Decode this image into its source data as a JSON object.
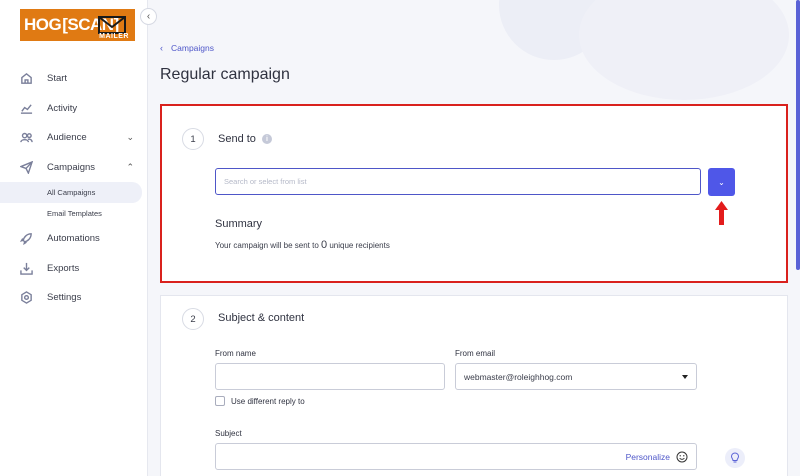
{
  "logo": {
    "hog": "HOG",
    "scan": "[SCAN]",
    "mailer": "MAILER"
  },
  "sidebar": {
    "items": [
      {
        "label": "Start",
        "icon": "home-icon"
      },
      {
        "label": "Activity",
        "icon": "chart-icon"
      },
      {
        "label": "Audience",
        "icon": "users-icon",
        "chevron": "⌄"
      },
      {
        "label": "Campaigns",
        "icon": "send-icon",
        "chevron": "⌃"
      },
      {
        "label": "Automations",
        "icon": "rocket-icon"
      },
      {
        "label": "Exports",
        "icon": "download-icon"
      },
      {
        "label": "Settings",
        "icon": "gear-icon"
      }
    ],
    "sub_items": [
      {
        "label": "All Campaigns",
        "active": true
      },
      {
        "label": "Email Templates",
        "active": false
      }
    ]
  },
  "breadcrumb": {
    "label": "Campaigns"
  },
  "page": {
    "title": "Regular campaign"
  },
  "send_to": {
    "step": "1",
    "title": "Send to",
    "placeholder": "Search or select from list",
    "summary_title": "Summary",
    "summary_prefix": "Your campaign will be sent to",
    "count": "0",
    "summary_suffix": "unique recipients"
  },
  "subject_content": {
    "step": "2",
    "title": "Subject & content",
    "from_name_label": "From name",
    "from_name_value": "",
    "from_email_label": "From email",
    "from_email_value": "webmaster@roleighhog.com",
    "reply_to_label": "Use different reply to",
    "subject_label": "Subject",
    "personalize_label": "Personalize"
  },
  "colors": {
    "accent": "#4f57e8",
    "highlight": "#d9211d",
    "logo": "#e07a13"
  }
}
